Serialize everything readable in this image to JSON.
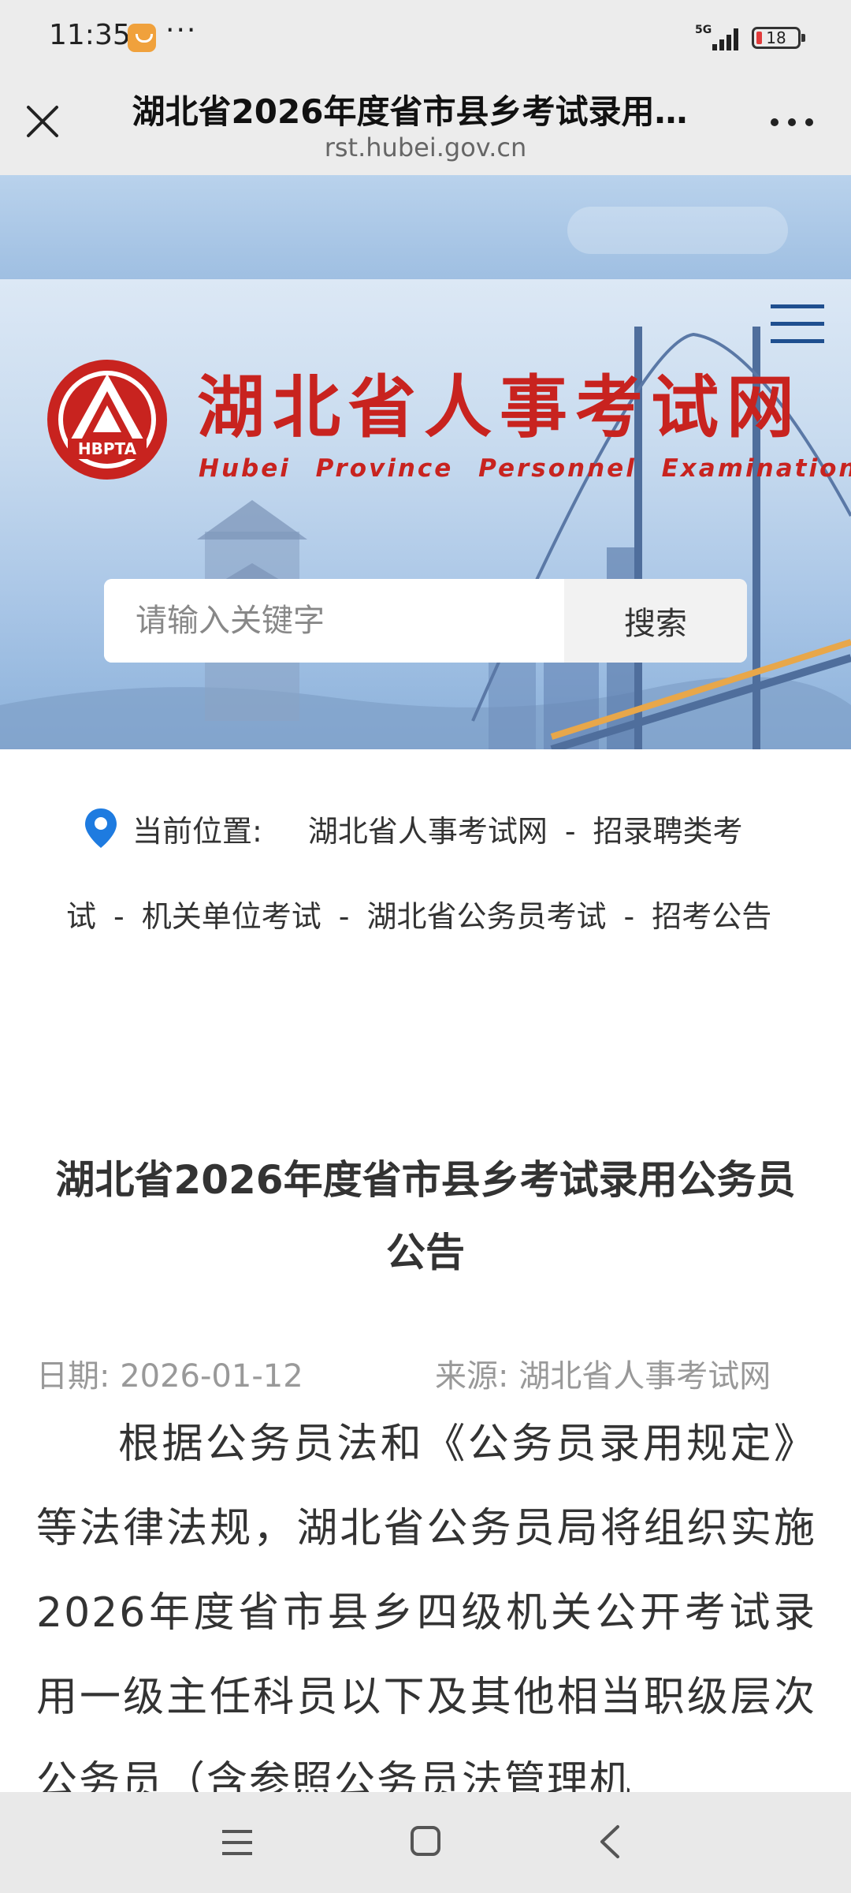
{
  "status_bar": {
    "time": "11:35",
    "battery": "18",
    "network": "5G"
  },
  "browser": {
    "title": "湖北省2026年度省市县乡考试录用…",
    "url": "rst.hubei.gov.cn"
  },
  "site": {
    "name_cn": "湖北省人事考试网",
    "name_en": "Hubei Province Personnel Examination",
    "emblem_text": "HBPTA",
    "brand_color": "#c8231f"
  },
  "search": {
    "placeholder": "请输入关键字",
    "button_label": "搜索"
  },
  "breadcrumb": {
    "label": "当前位置:",
    "items": [
      "湖北省人事考试网",
      "招录聘类考试",
      "机关单位考试",
      "湖北省公务员考试",
      "招考公告"
    ],
    "separator": "-"
  },
  "article": {
    "title": "湖北省2026年度省市县乡考试录用公务员公告",
    "date": "日期: 2026-01-12",
    "source": "来源: 湖北省人事考试网",
    "body": "根据公务员法和《公务员录用规定》等法律法规，湖北省公务员局将组织实施2026年度省市县乡四级机关公开考试录用一级主任科员以下及其他相当职级层次公务员（含参照公务员法管理机"
  }
}
